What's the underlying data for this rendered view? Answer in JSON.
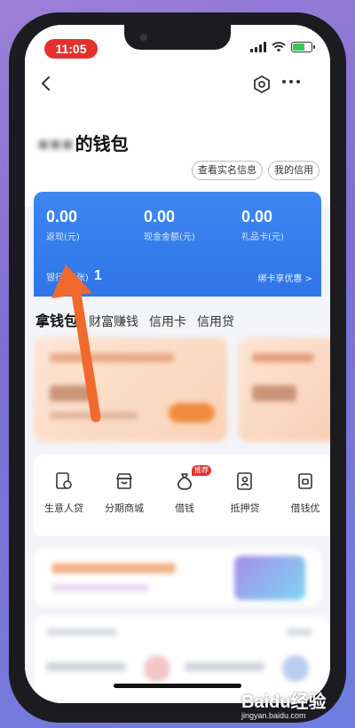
{
  "status_bar": {
    "time": "11:05",
    "time_pill_color": "#e5312d",
    "icons": [
      "signal-icon",
      "wifi-icon",
      "battery-charging-icon"
    ]
  },
  "nav": {
    "icons": [
      "back-icon",
      "settings-icon",
      "more-icon"
    ]
  },
  "wallet": {
    "title": "的钱包",
    "realname_button": "查看实名信息",
    "credit_button": "我的信用"
  },
  "summary": {
    "stats": [
      {
        "value": "0.00",
        "label": "返现(元)"
      },
      {
        "value": "0.00",
        "label": "现金金额(元)"
      },
      {
        "value": "0.00",
        "label": "礼品卡(元)"
      }
    ],
    "bank_card_label": "银行卡(张)",
    "bank_card_count": "1",
    "bind_offer_link": "绑卡享优惠 >",
    "card_color": "#3d86f0"
  },
  "tabs": [
    {
      "label": "拿钱包",
      "active": true
    },
    {
      "label": "财富赚钱",
      "active": false
    },
    {
      "label": "信用卡",
      "active": false
    },
    {
      "label": "信用贷",
      "active": false
    }
  ],
  "services": [
    {
      "label": "生意人贷",
      "icon": "doc-icon"
    },
    {
      "label": "分期商城",
      "icon": "shop-icon"
    },
    {
      "label": "借钱",
      "icon": "money-bag-icon",
      "badge": "推荐"
    },
    {
      "label": "抵押贷",
      "icon": "id-card-icon"
    },
    {
      "label": "借钱优",
      "icon": "wallet-icon"
    }
  ],
  "watermark": {
    "brand": "Baidu经验",
    "url": "jingyan.baidu.com"
  }
}
